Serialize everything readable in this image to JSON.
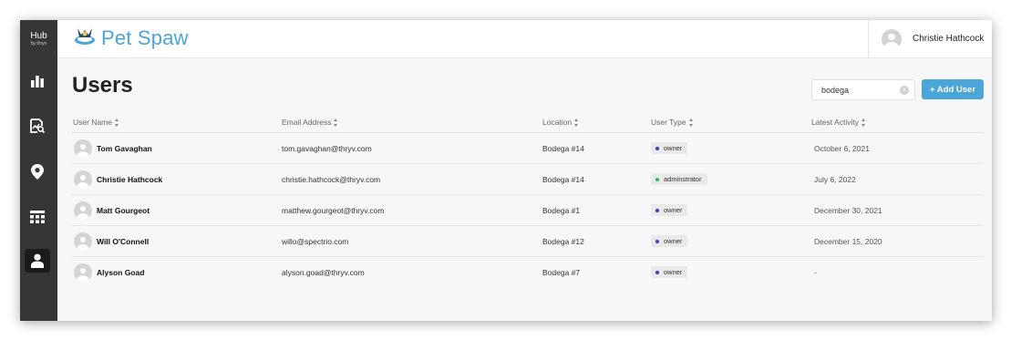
{
  "sidebar": {
    "logo_text": "Hub",
    "logo_sub": "by thryv",
    "items": [
      {
        "icon": "bar-chart-icon"
      },
      {
        "icon": "report-search-icon"
      },
      {
        "icon": "location-pin-icon"
      },
      {
        "icon": "apps-grid-icon"
      },
      {
        "icon": "user-icon",
        "active": true
      }
    ]
  },
  "header": {
    "brand": "Pet Spaw",
    "user_name": "Christie Hathcock"
  },
  "page": {
    "title": "Users",
    "search_value": "bodega",
    "add_user_label": "+ Add User"
  },
  "table": {
    "columns": {
      "user_name": "User Name",
      "email": "Email Address",
      "location": "Location",
      "user_type": "User Type",
      "activity": "Latest Activity"
    },
    "rows": [
      {
        "name": "Tom Gavaghan",
        "email": "tom.gavaghan@thryv.com",
        "location": "Bodega #14",
        "type": "owner",
        "activity": "October 6, 2021"
      },
      {
        "name": "Christie Hathcock",
        "email": "christie.hathcock@thryv.com",
        "location": "Bodega #14",
        "type": "adminstrator",
        "activity": "July 6, 2022"
      },
      {
        "name": "Matt Gourgeot",
        "email": "matthew.gourgeot@thryv.com",
        "location": "Bodega #1",
        "type": "owner",
        "activity": "December 30, 2021"
      },
      {
        "name": "Will O'Connell",
        "email": "willo@spectrio.com",
        "location": "Bodega #12",
        "type": "owner",
        "activity": "December 15, 2020"
      },
      {
        "name": "Alyson Goad",
        "email": "alyson.goad@thryv.com",
        "location": "Bodega #7",
        "type": "owner",
        "activity": "-"
      }
    ]
  },
  "colors": {
    "sidebar": "#363636",
    "accent": "#4aa5d8",
    "owner_dot": "#3b3fbf",
    "admin_dot": "#2fb36b"
  }
}
